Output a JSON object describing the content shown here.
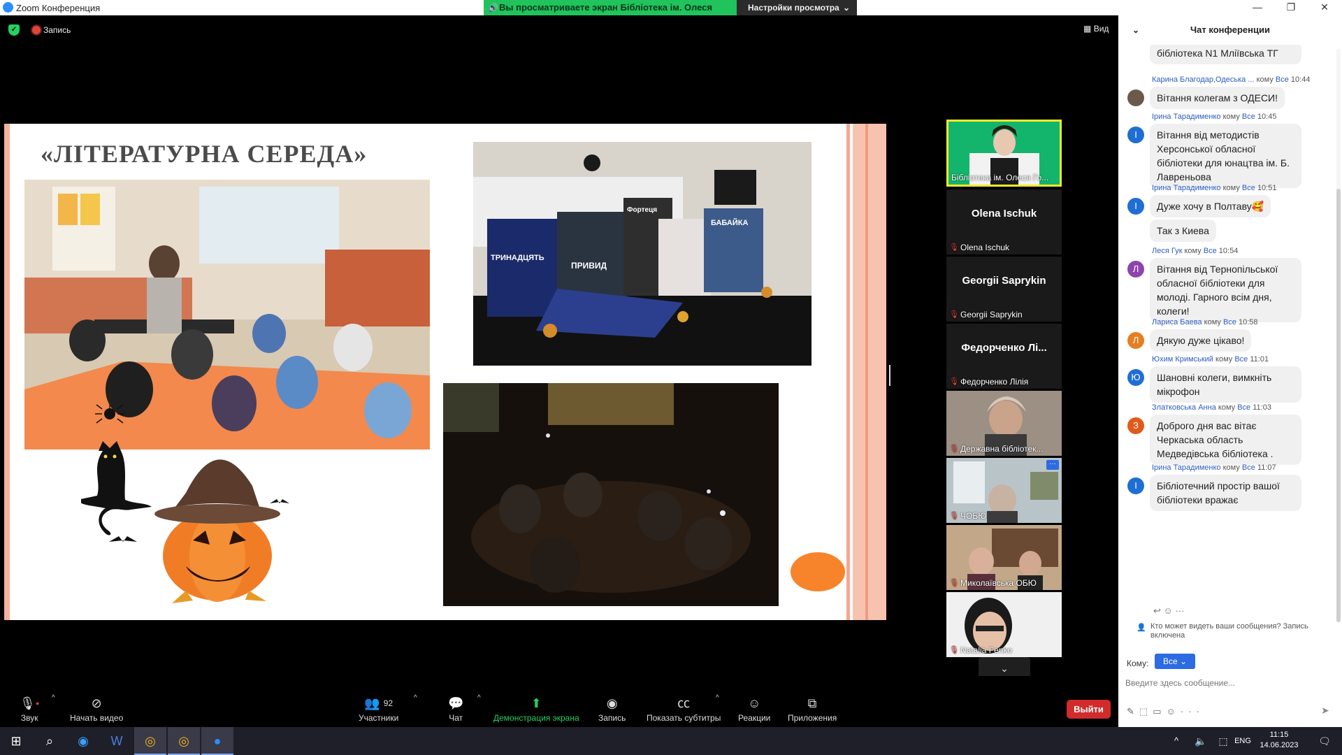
{
  "window": {
    "title": "Zoom Конференция",
    "share_banner": "Вы просматриваете экран Бібліотека ім. Олеся Гончара",
    "view_options": "Настройки просмотра",
    "min": "—",
    "max": "❐",
    "close": "✕"
  },
  "meeting": {
    "recording_label": "Запись",
    "view_label": "Вид"
  },
  "slide": {
    "title": "«ЛІТЕРАТУРНА СЕРЕДА»",
    "book_covers": [
      "ТРИНАДЦЯТЬ",
      "ПРИВИД",
      "Фортеця",
      "БАБАЙКА"
    ]
  },
  "participants_strip": {
    "tiles": [
      {
        "name": "",
        "label": "Бібліотека ім. Олеся Го...",
        "muted": false,
        "active": true
      },
      {
        "name": "Olena Ischuk",
        "label": "Olena Ischuk",
        "muted": true
      },
      {
        "name": "Georgii Saprykin",
        "label": "Georgii Saprykin",
        "muted": true
      },
      {
        "name": "Федорченко  Лі...",
        "label": "Федорченко Лілія",
        "muted": true
      },
      {
        "name": "",
        "label": "Державна бібліотек...",
        "muted": true
      },
      {
        "name": "",
        "label": "ЧОБЮ",
        "muted": true
      },
      {
        "name": "",
        "label": "Миколаївська ОБЮ",
        "muted": true
      },
      {
        "name": "",
        "label": "Natalia Fenko",
        "muted": true
      }
    ]
  },
  "toolbar": {
    "audio": "Звук",
    "video": "Начать видео",
    "participants": "Участники",
    "participants_count": "92",
    "chat": "Чат",
    "share": "Демонстрация экрана",
    "record": "Запись",
    "captions": "Показать субтитры",
    "reactions": "Реакции",
    "apps": "Приложения",
    "leave": "Выйти"
  },
  "chat": {
    "header": "Чат конференции",
    "messages": [
      {
        "sender": "",
        "text": "бібліотека N1 Мліївська ТГ",
        "initial": "",
        "color": ""
      },
      {
        "sender": "Карина Благодар,Одеська ...",
        "to": "кому",
        "target": "Все",
        "time": "10:44",
        "text": "Вітання колегам з ОДЕСИ!",
        "initial": "",
        "color": "#6b5a4a"
      },
      {
        "sender": "Ірина Тарадименко",
        "to": "кому",
        "target": "Все",
        "time": "10:45",
        "text": "Вітання від методистів Херсонської обласної бібліотеки для юнацтва ім. Б. Лавреньова",
        "initial": "I",
        "color": "#1f6ed4"
      },
      {
        "sender": "Ірина Тарадименко",
        "to": "кому",
        "target": "Все",
        "time": "10:51",
        "text": "Дуже хочу в Полтаву🥰",
        "initial": "I",
        "color": "#1f6ed4"
      },
      {
        "sender": "",
        "text": "Так з Киева",
        "initial": "",
        "color": ""
      },
      {
        "sender": "Леся Гук",
        "to": "кому",
        "target": "Все",
        "time": "10:54",
        "text": "Вітання від Тернопільської обласної бібліотеки для молоді. Гарного всім дня, колеги!",
        "initial": "Л",
        "color": "#8e44ad"
      },
      {
        "sender": "Лариса Баева",
        "to": "кому",
        "target": "Все",
        "time": "10:58",
        "text": "Дякую дуже цікаво!",
        "initial": "Л",
        "color": "#e67e22"
      },
      {
        "sender": "Юхим Кримський",
        "to": "кому",
        "target": "Все",
        "time": "11:01",
        "text": "Шановні колеги, вимкніть мікрофон",
        "initial": "Ю",
        "color": "#1f6ed4"
      },
      {
        "sender": "Златковська Анна",
        "to": "кому",
        "target": "Все",
        "time": "11:03",
        "text": "Доброго дня вас вітає Черкаська область Медведівська бібліотека .",
        "initial": "З",
        "color": "#e05a1a"
      },
      {
        "sender": "Ірина Тарадименко",
        "to": "кому",
        "target": "Все",
        "time": "11:07",
        "text": "Бібліотечний простір вашої бібліотеки вражає",
        "initial": "I",
        "color": "#1f6ed4"
      }
    ],
    "privacy_note": "Кто может видеть ваши сообщения? Запись включена",
    "to_label": "Кому:",
    "to_value": "Все",
    "input_placeholder": "Введите здесь сообщение..."
  },
  "taskbar": {
    "lang": "ENG",
    "time": "11:15",
    "date": "14.06.2023"
  }
}
